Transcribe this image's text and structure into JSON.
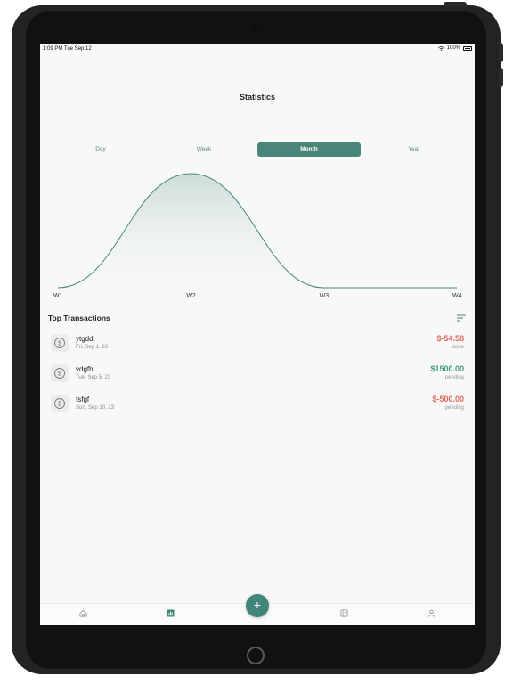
{
  "status_bar": {
    "time": "1:09 PM   Tue Sep 12",
    "battery": "100%"
  },
  "screen": {
    "title": "Statistics"
  },
  "periods": [
    {
      "label": "Day",
      "active": false
    },
    {
      "label": "Week",
      "active": false
    },
    {
      "label": "Month",
      "active": true
    },
    {
      "label": "Year",
      "active": false
    }
  ],
  "chart_data": {
    "type": "area",
    "categories": [
      "W1",
      "W2",
      "W3",
      "W4"
    ],
    "values": [
      0,
      1,
      0,
      0
    ],
    "curve": "smooth",
    "line_color": "#4a857a"
  },
  "transactions_section": {
    "title": "Top Transactions"
  },
  "transactions": [
    {
      "name": "ytgdd",
      "date": "Fri, Sep 1, 23",
      "amount": "$-54.58",
      "status": "done",
      "type": "negative"
    },
    {
      "name": "vdgfh",
      "date": "Tue, Sep 5, 23",
      "amount": "$1500.00",
      "status": "pending",
      "type": "positive"
    },
    {
      "name": "fsfgf",
      "date": "Sun, Sep 10, 23",
      "amount": "$-500.00",
      "status": "pending",
      "type": "negative"
    }
  ],
  "fab": {
    "label": "+"
  },
  "tabs": [
    {
      "name": "home-icon"
    },
    {
      "name": "chart-icon"
    },
    {
      "name": "wallet-icon"
    },
    {
      "name": "profile-icon"
    }
  ],
  "colors": {
    "accent": "#4a857a",
    "negative": "#e0685c",
    "positive": "#3f9a79"
  }
}
